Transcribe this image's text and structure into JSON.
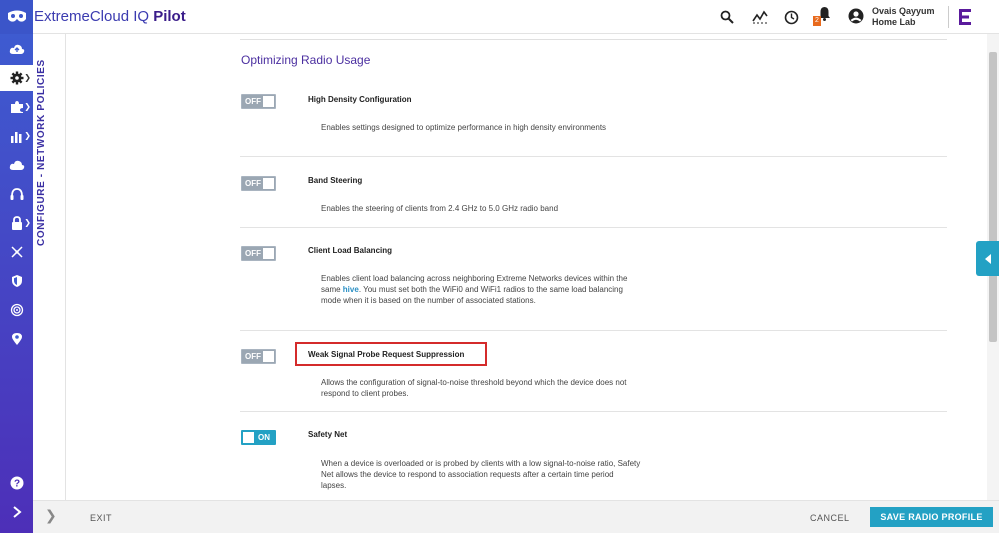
{
  "app": {
    "brand_name": "ExtremeCloud IQ",
    "brand_suffix": "Pilot"
  },
  "user": {
    "name": "Ovais Qayyum",
    "org": "Home Lab",
    "notification_count": "2"
  },
  "breadcrumb": "CONFIGURE - NETWORK POLICIES",
  "section": {
    "title": "Optimizing Radio Usage"
  },
  "settings": [
    {
      "title": "High Density Configuration",
      "state": "OFF",
      "description": "Enables settings designed to optimize performance in high density environments"
    },
    {
      "title": "Band Steering",
      "state": "OFF",
      "description": "Enables the steering of clients from 2.4 GHz to 5.0 GHz radio band"
    },
    {
      "title": "Client Load Balancing",
      "state": "OFF",
      "description_pre": "Enables client load balancing across neighboring Extreme Networks devices within the same ",
      "description_link": "hive",
      "description_post": ". You must set both the WiFi0 and WiFi1 radios to the same load balancing mode when it is based on the number of associated stations."
    },
    {
      "title": "Weak Signal Probe Request Suppression",
      "state": "OFF",
      "description": "Allows the configuration of signal-to-noise threshold beyond which the device does not respond to client probes."
    },
    {
      "title": "Safety Net",
      "state": "ON",
      "description": "When a device is overloaded or is probed by clients with a low signal-to-noise ratio, Safety Net allows the device to respond to association requests after a certain time period lapses."
    }
  ],
  "footer": {
    "exit_label": "EXIT",
    "cancel_label": "CANCEL",
    "save_label": "SAVE RADIO PROFILE"
  },
  "sidebar_icons": [
    "cloud-upload-icon",
    "gear-icon",
    "puzzle-icon",
    "bar-chart-icon",
    "cloud-icon",
    "headset-icon",
    "lock-icon",
    "network-icon",
    "shield-icon",
    "radar-icon",
    "location-pin-icon",
    "help-icon",
    "expand-icon"
  ],
  "colors": {
    "accent": "#23a1c4",
    "sidebar": "#3e5bd0",
    "brand_text": "#3a1c8a",
    "highlight": "#d42b2b"
  }
}
